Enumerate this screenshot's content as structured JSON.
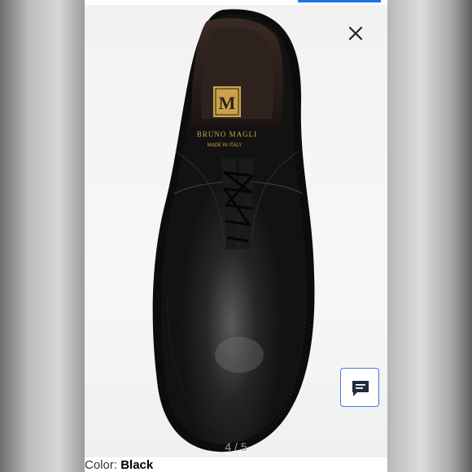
{
  "viewer": {
    "image_counter": "4 / 5",
    "close_icon": "close-icon",
    "chat_icon": "chat-bubble-icon"
  },
  "product": {
    "brand_mark_letter": "M",
    "brand_name": "BRUNO MAGLI",
    "made_in": "MADE IN ITALY",
    "image_alt": "Black leather lace-up oxford shoe, top view"
  },
  "color_field": {
    "label": "Color:",
    "value": "Black"
  },
  "colors": {
    "accent_blue": "#1a73e8",
    "chat_border": "#3b7ddd",
    "shoe_black": "#151515",
    "logo_gold": "#c9a24a"
  }
}
